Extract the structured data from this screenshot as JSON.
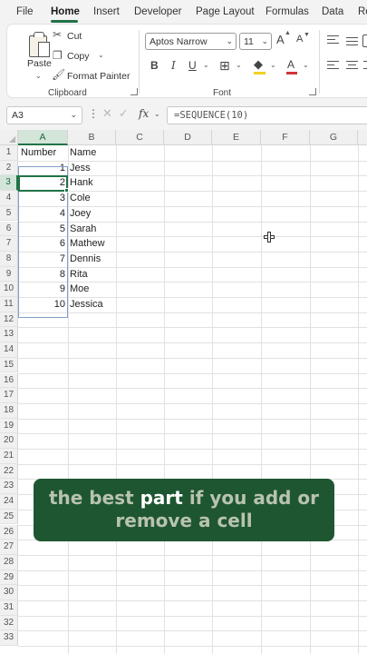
{
  "menu": {
    "tabs": [
      "File",
      "Home",
      "Insert",
      "Developer",
      "Page Layout",
      "Formulas",
      "Data",
      "Re"
    ],
    "active": "Home"
  },
  "ribbon": {
    "clipboard": {
      "paste": "Paste",
      "cut": "Cut",
      "copy": "Copy",
      "format_painter": "Format Painter",
      "label": "Clipboard"
    },
    "font": {
      "name": "Aptos Narrow",
      "size": "11",
      "grow": "A",
      "shrink": "A",
      "bold": "B",
      "italic": "I",
      "underline": "U",
      "font_color": "A",
      "label": "Font"
    }
  },
  "formula_bar": {
    "name_box": "A3",
    "fx": "fx",
    "formula": "=SEQUENCE(10)"
  },
  "grid": {
    "columns": [
      "A",
      "B",
      "C",
      "D",
      "E",
      "F",
      "G"
    ],
    "rows": [
      "1",
      "2",
      "3",
      "4",
      "5",
      "6",
      "7",
      "8",
      "9",
      "10",
      "11",
      "12",
      "13",
      "14",
      "15",
      "16",
      "17",
      "18",
      "19",
      "20",
      "21",
      "22",
      "23",
      "24",
      "25",
      "26",
      "27",
      "28",
      "29",
      "30",
      "31",
      "32",
      "33"
    ],
    "header_a": "Number",
    "header_b": "Name",
    "numbers": [
      "1",
      "2",
      "3",
      "4",
      "5",
      "6",
      "7",
      "8",
      "9",
      "10"
    ],
    "names": [
      "Jess",
      "Hank",
      "Cole",
      "Joey",
      "Sarah",
      "Mathew",
      "Dennis",
      "Rita",
      "Moe",
      "Jessica"
    ],
    "selected_cell": "A3"
  },
  "caption": {
    "before": "the best ",
    "highlight": "part",
    "after": " if you add or remove a cell"
  },
  "colors": {
    "accent": "#217346",
    "caption_bg": "#1e5631",
    "caption_text": "#b8c3b0"
  }
}
